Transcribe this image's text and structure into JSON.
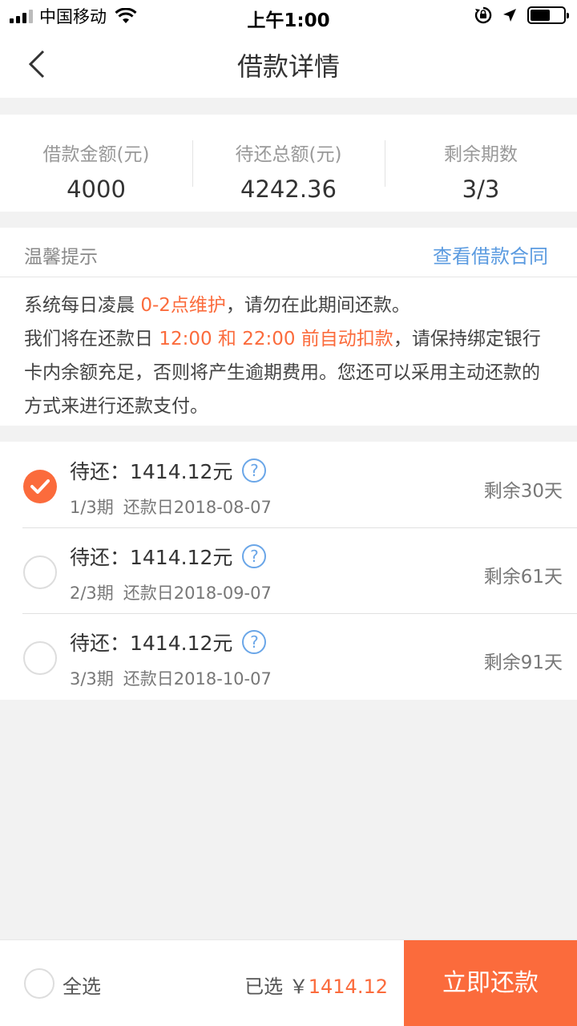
{
  "status_bar": {
    "carrier": "中国移动",
    "time": "上午1:00"
  },
  "nav": {
    "title": "借款详情"
  },
  "summary": {
    "loan_amount_label": "借款金额(元)",
    "loan_amount_value": "4000",
    "total_due_label": "待还总额(元)",
    "total_due_value": "4242.36",
    "remaining_periods_label": "剩余期数",
    "remaining_periods_value": "3/3"
  },
  "tips": {
    "title": "温馨提示",
    "contract_link": "查看借款合同",
    "line1_pre": "系统每日凌晨 ",
    "line1_hl": "0-2点维护",
    "line1_post": "，请勿在此期间还款。",
    "line2_pre": "我们将在还款日 ",
    "line2_hl": "12:00 和 22:00 前自动扣款",
    "line2_post": "，请保持绑定银行卡内余额充足，否则将产生逾期费用。您还可以采用主动还款的方式来进行还款支付。"
  },
  "installments": [
    {
      "amount": "待还：1414.12元",
      "period": "1/3期",
      "due_date": "还款日2018-08-07",
      "days_left": "剩余30天",
      "checked": true
    },
    {
      "amount": "待还：1414.12元",
      "period": "2/3期",
      "due_date": "还款日2018-09-07",
      "days_left": "剩余61天",
      "checked": false
    },
    {
      "amount": "待还：1414.12元",
      "period": "3/3期",
      "due_date": "还款日2018-10-07",
      "days_left": "剩余91天",
      "checked": false
    }
  ],
  "bottom": {
    "select_all_label": "全选",
    "selected_prefix": "已选 ￥",
    "selected_amount": "1414.12",
    "pay_button": "立即还款"
  },
  "colors": {
    "accent": "#fb6b3c",
    "link": "#5b9be0"
  }
}
